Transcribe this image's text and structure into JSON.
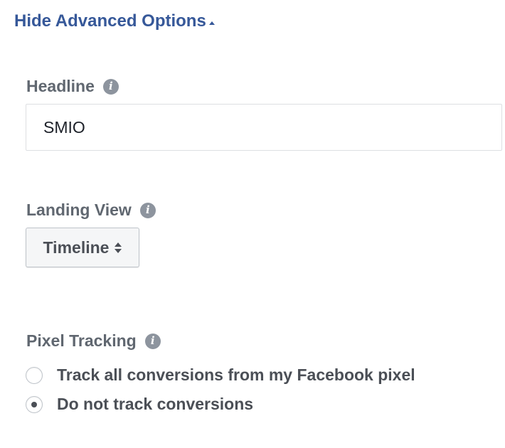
{
  "advanced_toggle": {
    "label": "Hide Advanced Options",
    "icon": "caret-up-icon"
  },
  "headline": {
    "label": "Headline",
    "value": "SMIO",
    "info_icon": "i"
  },
  "landing_view": {
    "label": "Landing View",
    "selected": "Timeline",
    "info_icon": "i"
  },
  "pixel_tracking": {
    "label": "Pixel Tracking",
    "info_icon": "i",
    "options": [
      {
        "label": "Track all conversions from my Facebook pixel",
        "selected": false
      },
      {
        "label": "Do not track conversions",
        "selected": true
      }
    ]
  },
  "colors": {
    "link": "#365899",
    "label": "#606770",
    "text": "#4b4f56",
    "info_icon_bg": "#8d949e"
  }
}
